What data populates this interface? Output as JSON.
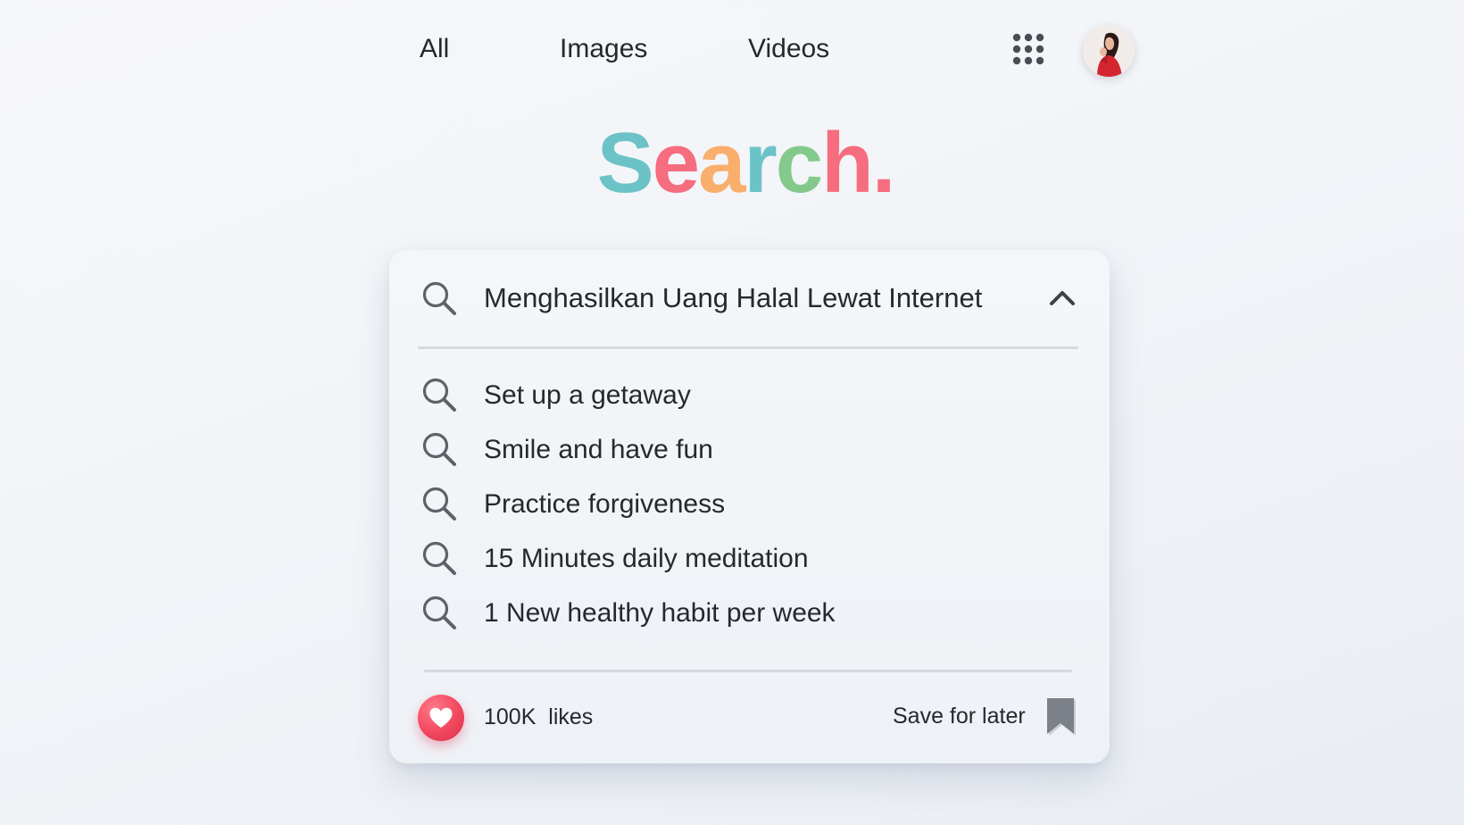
{
  "nav": {
    "links": [
      {
        "label": "All"
      },
      {
        "label": "Images"
      },
      {
        "label": "Videos"
      }
    ],
    "apps_icon": "grid-dots-icon",
    "avatar_icon": "user-avatar"
  },
  "logo": {
    "letters": [
      {
        "char": "S",
        "color": "#6cc3c7"
      },
      {
        "char": "e",
        "color": "#f56d7e"
      },
      {
        "char": "a",
        "color": "#f9ae6b"
      },
      {
        "char": "r",
        "color": "#6cc3c7"
      },
      {
        "char": "c",
        "color": "#84c98c"
      },
      {
        "char": "h",
        "color": "#f56d7e"
      },
      {
        "char": ".",
        "color": "#f56d7e"
      }
    ]
  },
  "search": {
    "query": "Menghasilkan Uang Halal Lewat Internet",
    "icon": "search-icon",
    "collapse_icon": "chevron-up-icon",
    "suggestions": [
      {
        "label": "Set up a getaway"
      },
      {
        "label": "Smile and have fun"
      },
      {
        "label": "Practice forgiveness"
      },
      {
        "label": "15 Minutes daily meditation"
      },
      {
        "label": "1 New healthy habit per week"
      }
    ]
  },
  "footer": {
    "likes": "100K  likes",
    "save_label": "Save for later",
    "like_icon": "heart-icon",
    "bookmark_icon": "bookmark-icon"
  },
  "colors": {
    "accent_red": "#f2475e",
    "icon_gray": "#5e6168",
    "text": "#25282d"
  }
}
